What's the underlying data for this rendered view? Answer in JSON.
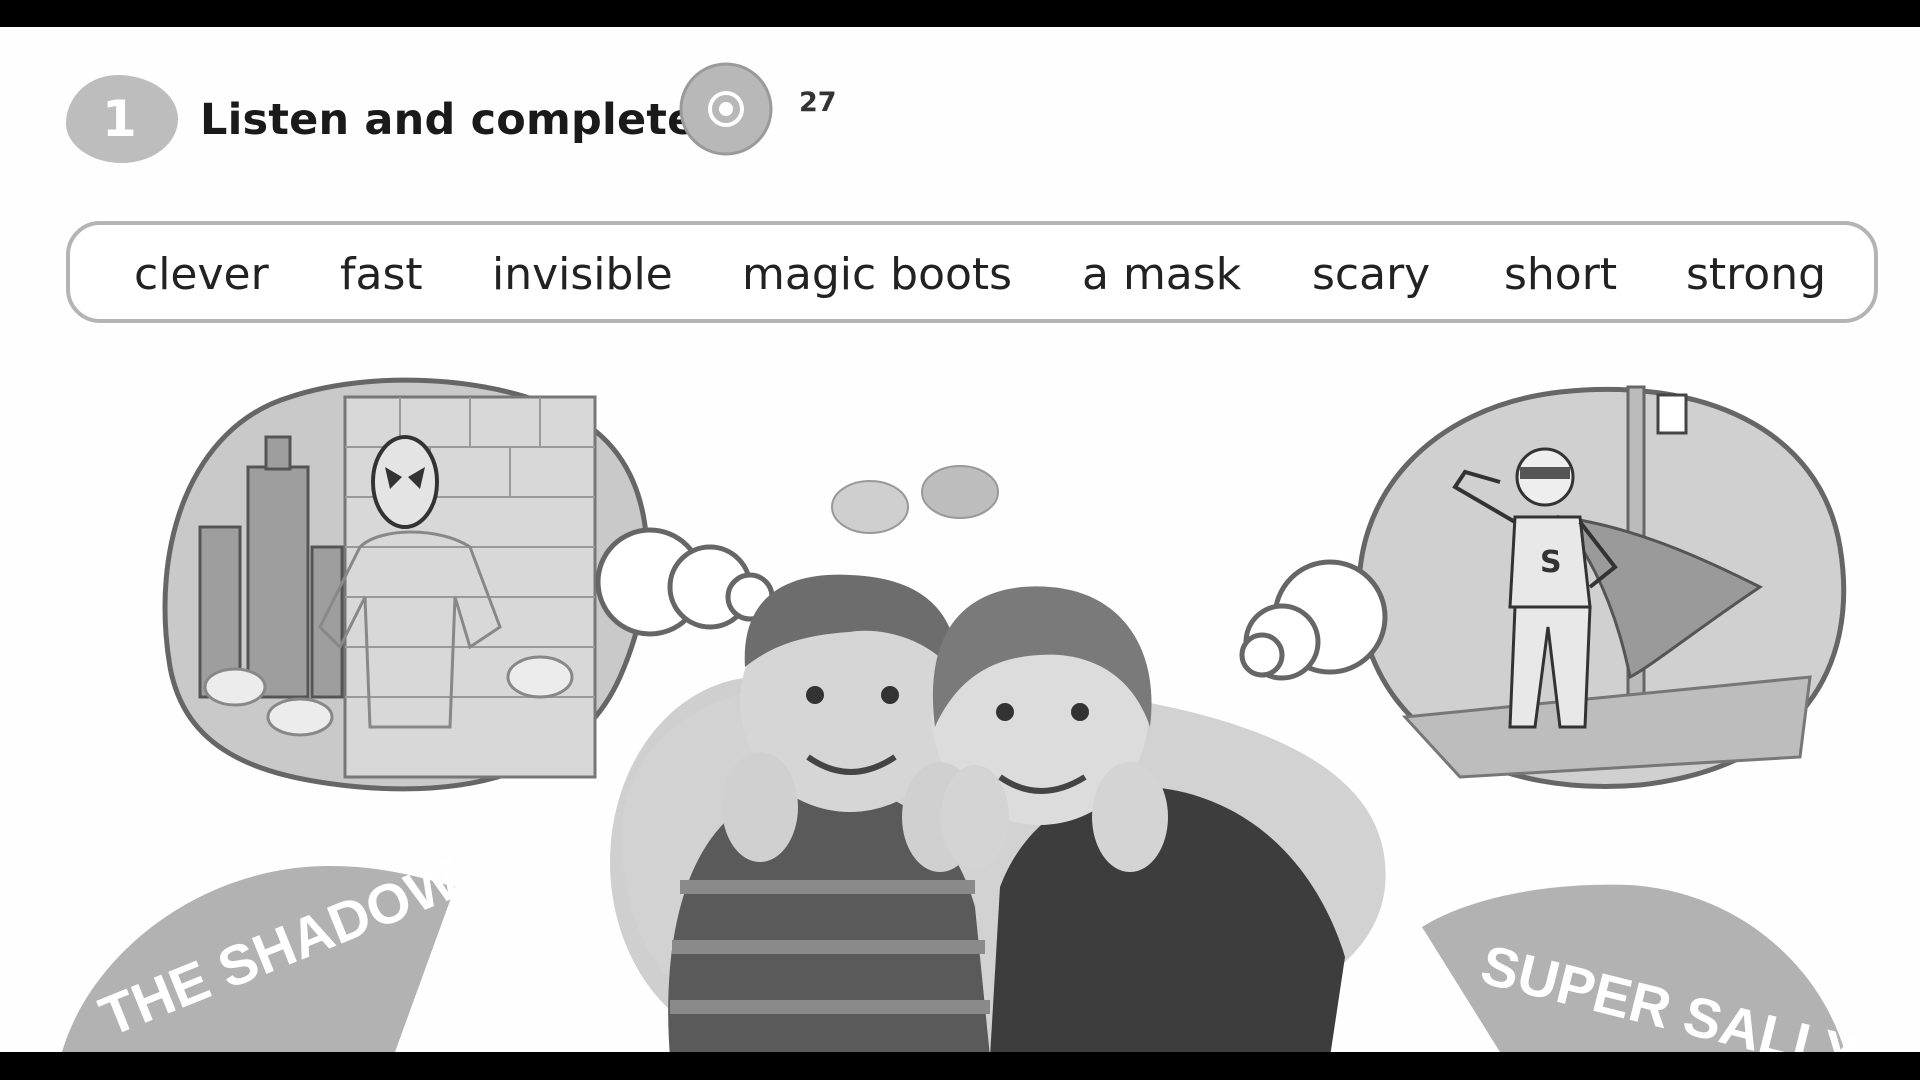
{
  "exercise": {
    "number": "1",
    "instruction": "Listen and complete.",
    "track": "27",
    "icons": {
      "audio": "cd-icon"
    }
  },
  "word_box": {
    "words": [
      "clever",
      "fast",
      "invisible",
      "magic boots",
      "a mask",
      "scary",
      "short",
      "strong"
    ]
  },
  "illustrations": {
    "left_banner": "THE SHADOW",
    "right_banner": "SUPER SALLY",
    "right_hero_emblem": "S"
  }
}
